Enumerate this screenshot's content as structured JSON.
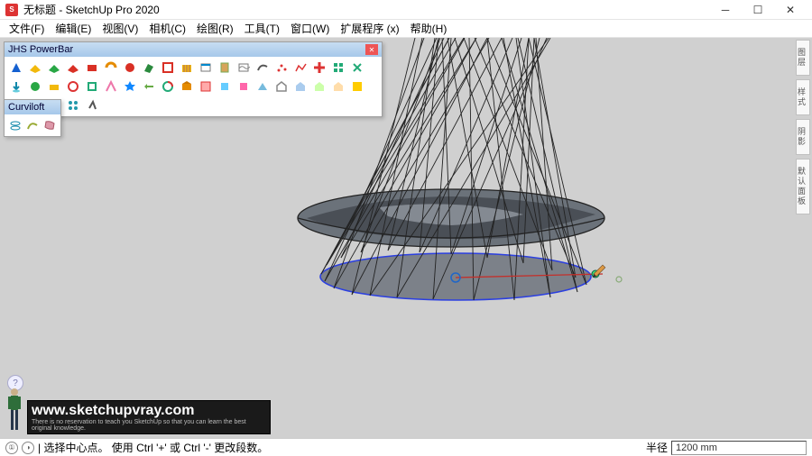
{
  "titlebar": {
    "app_icon_letter": "S",
    "title": "无标题 - SketchUp Pro 2020"
  },
  "menus": [
    "文件(F)",
    "编辑(E)",
    "视图(V)",
    "相机(C)",
    "绘图(R)",
    "工具(T)",
    "窗口(W)",
    "扩展程序 (x)",
    "帮助(H)"
  ],
  "jhs": {
    "title": "JHS PowerBar"
  },
  "curviloft": {
    "title": "Curviloft"
  },
  "right_tabs": [
    "图层",
    "样式",
    "阴影",
    "默认面板"
  ],
  "watermark": {
    "main": "www.sketchupvray.com",
    "sub": "There is no reservation to teach you SketchUp so that you can learn the best original knowledge."
  },
  "statusbar": {
    "info_glyph": "①",
    "user_glyph": "◑",
    "text": "| 选择中心点。 使用 Ctrl '+' 或 Ctrl '-' 更改段数。",
    "measure_label": "半径",
    "measure_value": "1200 mm"
  },
  "hint_glyph": "?"
}
